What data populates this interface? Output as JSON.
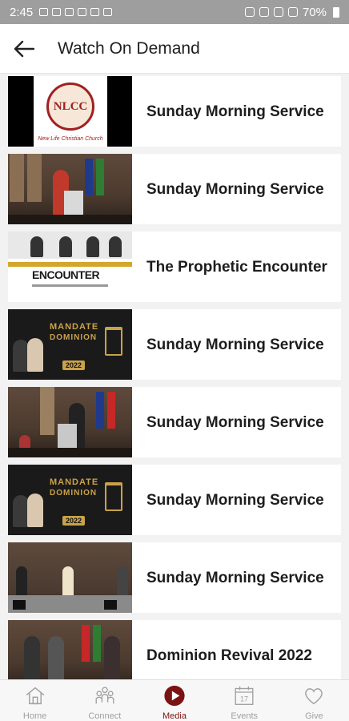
{
  "status_bar": {
    "time": "2:45",
    "battery": "70%"
  },
  "header": {
    "title": "Watch On Demand",
    "back_icon": "back-arrow-icon"
  },
  "items": [
    {
      "label": "Sunday Morning Service",
      "thumb_text": "NLCC",
      "thumb_sub": "New Life Christian Church"
    },
    {
      "label": "Sunday Morning Service"
    },
    {
      "label": "The Prophetic Encounter",
      "thumb_text": "ENCOUNTER"
    },
    {
      "label": "Sunday Morning Service",
      "thumb_text": "MANDATE",
      "thumb_text2": "DOMINION",
      "thumb_year": "2022"
    },
    {
      "label": "Sunday Morning Service"
    },
    {
      "label": "Sunday Morning Service",
      "thumb_text": "MANDATE",
      "thumb_text2": "DOMINION",
      "thumb_year": "2022"
    },
    {
      "label": "Sunday Morning Service"
    },
    {
      "label": "Dominion Revival 2022"
    }
  ],
  "tabs": [
    {
      "label": "Home",
      "icon": "home-icon",
      "active": false
    },
    {
      "label": "Connect",
      "icon": "people-icon",
      "active": false
    },
    {
      "label": "Media",
      "icon": "play-icon",
      "active": true
    },
    {
      "label": "Events",
      "icon": "calendar-icon",
      "active": false
    },
    {
      "label": "Give",
      "icon": "heart-icon",
      "active": false
    }
  ],
  "calendar_day": "17",
  "colors": {
    "accent": "#7a1414",
    "status_bar": "#9e9e9e",
    "tab_inactive": "#a0a0a0"
  }
}
